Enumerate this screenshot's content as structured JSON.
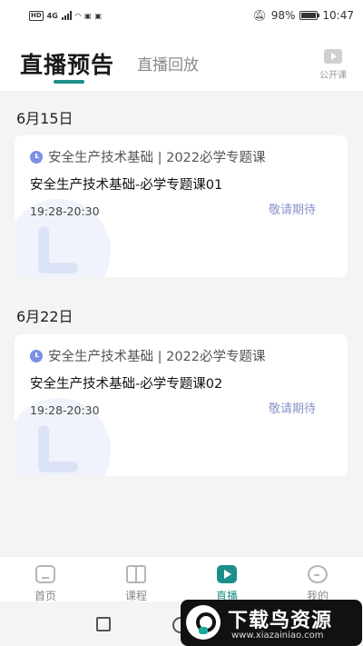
{
  "status_bar": {
    "net_label": "HD",
    "signal_label": "4G",
    "battery": "98%",
    "time": "10:47"
  },
  "header": {
    "tabs": [
      {
        "label": "直播预告",
        "active": true
      },
      {
        "label": "直播回放",
        "active": false
      }
    ],
    "public_course_label": "公开课"
  },
  "sections": [
    {
      "date": "6月15日",
      "card": {
        "category": "安全生产技术基础 | 2022必学专题课",
        "title": "安全生产技术基础-必学专题课01",
        "time": "19:28-20:30",
        "status": "敬请期待"
      }
    },
    {
      "date": "6月22日",
      "card": {
        "category": "安全生产技术基础 | 2022必学专题课",
        "title": "安全生产技术基础-必学专题课02",
        "time": "19:28-20:30",
        "status": "敬请期待"
      }
    }
  ],
  "bottom_nav": [
    {
      "label": "首页",
      "icon": "home-icon",
      "active": false
    },
    {
      "label": "课程",
      "icon": "book-icon",
      "active": false
    },
    {
      "label": "直播",
      "icon": "play-icon",
      "active": true
    },
    {
      "label": "我的",
      "icon": "profile-icon",
      "active": false
    }
  ],
  "watermark": {
    "title": "下载鸟资源",
    "url": "www.xiazainiao.com"
  },
  "colors": {
    "accent": "#1c8f8b",
    "status_text": "#8a93c9",
    "clock_icon": "#7d8fe6"
  }
}
